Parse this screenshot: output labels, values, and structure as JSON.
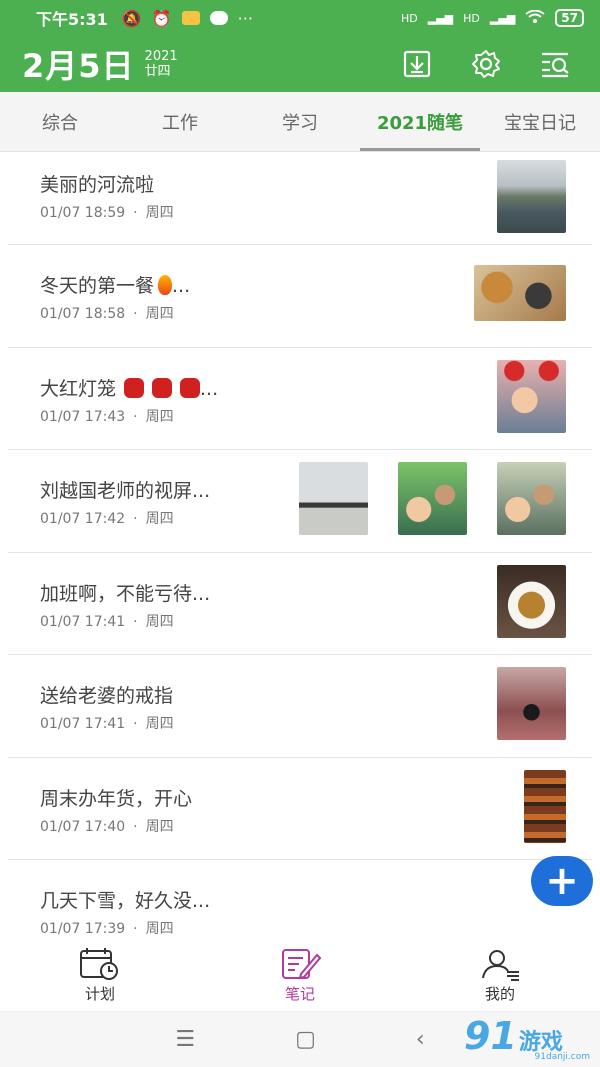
{
  "status": {
    "time": "下午5:31",
    "network1": "HD",
    "network2": "HD",
    "battery": "57"
  },
  "header": {
    "date": "2月5日",
    "year": "2021",
    "lunar": "廿四"
  },
  "tabs": [
    {
      "label": "综合"
    },
    {
      "label": "工作"
    },
    {
      "label": "学习"
    },
    {
      "label": "2021随笔",
      "active": true
    },
    {
      "label": "宝宝日记"
    }
  ],
  "notes": [
    {
      "title": "美丽的河流啦",
      "time": "01/07 18:59",
      "sep": "·",
      "weekday": "周四",
      "thumbs": [
        "river"
      ]
    },
    {
      "title": "冬天的第一餐",
      "time": "01/07 18:58",
      "sep": "·",
      "weekday": "周四",
      "thumbs": [
        "food-table"
      ]
    },
    {
      "title": "大红灯笼",
      "time": "01/07 17:43",
      "sep": "·",
      "weekday": "周四",
      "thumbs": [
        "baby-lanterns"
      ]
    },
    {
      "title": "刘越国老师的视屏...",
      "time": "01/07 17:42",
      "sep": "·",
      "weekday": "周四",
      "thumbs": [
        "monitor",
        "family1",
        "family2"
      ]
    },
    {
      "title": "加班啊，不能亏待...",
      "time": "01/07 17:41",
      "sep": "·",
      "weekday": "周四",
      "thumbs": [
        "dish"
      ]
    },
    {
      "title": "送给老婆的戒指",
      "time": "01/07 17:41",
      "sep": "·",
      "weekday": "周四",
      "thumbs": [
        "ring"
      ]
    },
    {
      "title": "周末办年货，开心",
      "time": "01/07 17:40",
      "sep": "·",
      "weekday": "周四",
      "thumbs": [
        "market"
      ]
    },
    {
      "title": "几天下雪，好久没...",
      "time": "01/07 17:39",
      "sep": "·",
      "weekday": "周四",
      "thumbs": []
    }
  ],
  "item_suffix": "...",
  "fab": {
    "label": "+"
  },
  "bottom_nav": [
    {
      "label": "计划"
    },
    {
      "label": "笔记",
      "active": true
    },
    {
      "label": "我的"
    }
  ],
  "sysnav": {
    "menu": "☰",
    "home": "▢",
    "back": "‹"
  },
  "watermark": {
    "logo": "91",
    "text": "游戏",
    "sub": "91danji.com"
  },
  "colors": {
    "primary": "#4caf50",
    "tab_active": "#3b9c3e",
    "fab": "#1e6fd9",
    "nav_active": "#b03a9e"
  }
}
